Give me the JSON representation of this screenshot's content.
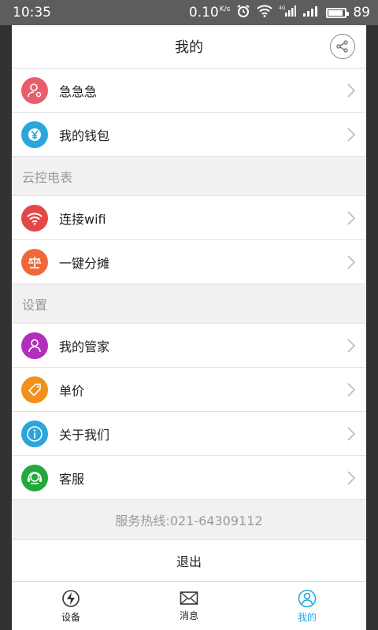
{
  "status_bar": {
    "time": "10:35",
    "speed": "0.10",
    "speed_unit": "K/s",
    "battery": "89"
  },
  "header": {
    "title": "我的"
  },
  "menu_group_1": [
    {
      "label": "急急急",
      "icon": "user-gear-icon",
      "color": "#e95e6d"
    },
    {
      "label": "我的钱包",
      "icon": "yen-icon",
      "color": "#2aa6dd"
    }
  ],
  "section_1": {
    "title": "云控电表"
  },
  "menu_group_2": [
    {
      "label": "连接wifi",
      "icon": "wifi-icon",
      "color": "#e54747"
    },
    {
      "label": "一键分摊",
      "icon": "scale-icon",
      "color": "#f0683a"
    }
  ],
  "section_2": {
    "title": "设置"
  },
  "menu_group_3": [
    {
      "label": "我的管家",
      "icon": "person-icon",
      "color": "#b12fbc"
    },
    {
      "label": "单价",
      "icon": "price-tag-icon",
      "color": "#f39019"
    },
    {
      "label": "关于我们",
      "icon": "info-icon",
      "color": "#2aa6dd"
    },
    {
      "label": "客服",
      "icon": "headset-icon",
      "color": "#22a93c"
    }
  ],
  "footer": {
    "hotline": "服务热线:021-64309112",
    "logout": "退出"
  },
  "tabbar": {
    "tabs": [
      {
        "label": "设备",
        "icon": "lightning-icon",
        "active": false
      },
      {
        "label": "消息",
        "icon": "envelope-icon",
        "active": false
      },
      {
        "label": "我的",
        "icon": "person-icon",
        "active": true
      }
    ],
    "active_color": "#27a7e1"
  }
}
